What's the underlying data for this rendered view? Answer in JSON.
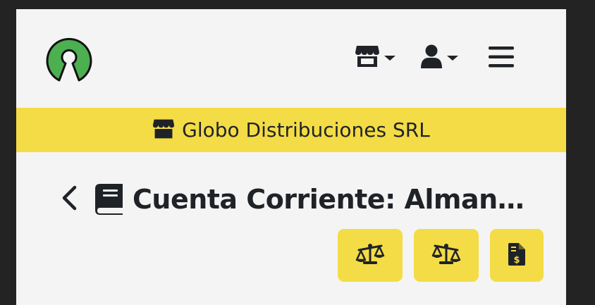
{
  "navbar": {
    "logo_icon": "open-source-keyhole-logo",
    "store_icon": "store-icon",
    "user_icon": "user-icon",
    "menu_icon": "hamburger-menu-icon"
  },
  "banner": {
    "icon": "store-icon",
    "company_name": "Globo Distribuciones SRL",
    "background": "#f3dc46"
  },
  "page": {
    "back_icon": "chevron-left-icon",
    "title_icon": "book-icon",
    "title": "Cuenta Corriente: Almand..."
  },
  "actions": [
    {
      "icon": "balance-scale-left-icon"
    },
    {
      "icon": "balance-scale-right-icon"
    },
    {
      "icon": "invoice-dollar-icon"
    }
  ],
  "colors": {
    "accent": "#f3dc46",
    "logo_green": "#4caf50",
    "text": "#1f2328",
    "page_bg": "#f4f4f4",
    "outer_bg": "#232323"
  }
}
